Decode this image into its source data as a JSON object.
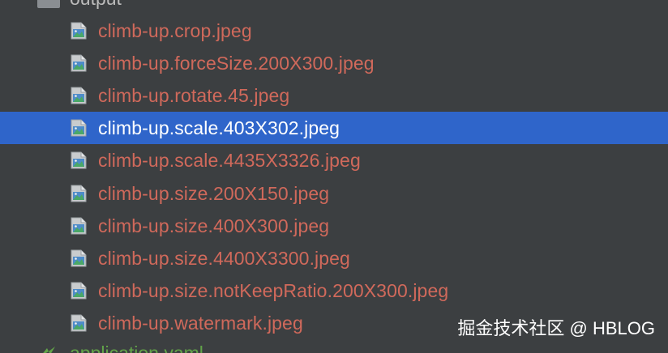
{
  "folder": {
    "label": "output",
    "icon": "folder-icon"
  },
  "files": [
    {
      "name": "climb-up.crop.jpeg",
      "selected": false,
      "icon": "image-file-icon"
    },
    {
      "name": "climb-up.forceSize.200X300.jpeg",
      "selected": false,
      "icon": "image-file-icon"
    },
    {
      "name": "climb-up.rotate.45.jpeg",
      "selected": false,
      "icon": "image-file-icon"
    },
    {
      "name": "climb-up.scale.403X302.jpeg",
      "selected": true,
      "icon": "image-file-icon"
    },
    {
      "name": "climb-up.scale.4435X3326.jpeg",
      "selected": false,
      "icon": "image-file-icon"
    },
    {
      "name": "climb-up.size.200X150.jpeg",
      "selected": false,
      "icon": "image-file-icon"
    },
    {
      "name": "climb-up.size.400X300.jpeg",
      "selected": false,
      "icon": "image-file-icon"
    },
    {
      "name": "climb-up.size.4400X3300.jpeg",
      "selected": false,
      "icon": "image-file-icon"
    },
    {
      "name": "climb-up.size.notKeepRatio.200X300.jpeg",
      "selected": false,
      "icon": "image-file-icon"
    },
    {
      "name": "climb-up.watermark.jpeg",
      "selected": false,
      "icon": "image-file-icon"
    }
  ],
  "yaml": {
    "label": "application.yaml",
    "icon": "yaml-file-icon"
  },
  "watermark": "掘金技术社区 @ HBLOG",
  "colors": {
    "background": "#3c3f41",
    "selection": "#2f65ca",
    "untracked_file_text": "#d0695b",
    "selected_text": "#ffffff",
    "yaml_text": "#62a349"
  }
}
